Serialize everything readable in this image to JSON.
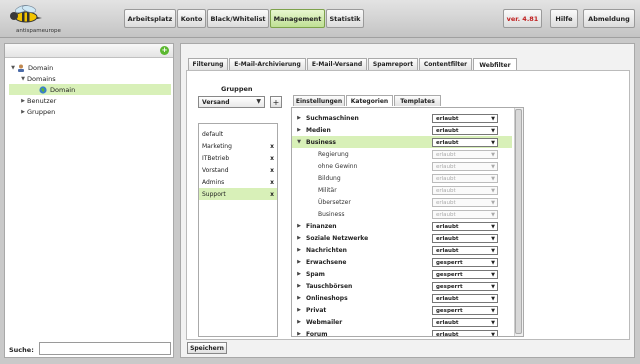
{
  "brand": {
    "logo_text": "antispameurope"
  },
  "nav": {
    "items": [
      {
        "label": "Arbeitsplatz"
      },
      {
        "label": "Konto"
      },
      {
        "label": "Black/Whitelist"
      },
      {
        "label": "Management"
      },
      {
        "label": "Statistik"
      }
    ],
    "version": "ver. 4.81",
    "help": "Hilfe",
    "logout": "Abmeldung"
  },
  "tree": {
    "nodes": [
      {
        "label": "Domain"
      },
      {
        "label": "Domains"
      },
      {
        "label": "Domain"
      },
      {
        "label": "Benutzer"
      },
      {
        "label": "Gruppen"
      }
    ]
  },
  "search": {
    "label": "Suche:",
    "value": ""
  },
  "tabs": [
    {
      "label": "Filterung"
    },
    {
      "label": "E-Mail-Archivierung"
    },
    {
      "label": "E-Mail-Versand"
    },
    {
      "label": "Spamreport"
    },
    {
      "label": "Contentfilter"
    },
    {
      "label": "Webfilter"
    }
  ],
  "groups": {
    "title": "Gruppen",
    "select_value": "Versand",
    "add_label": "+",
    "items": [
      {
        "label": "default",
        "removable": ""
      },
      {
        "label": "Marketing",
        "removable": "x"
      },
      {
        "label": "ITBetrieb",
        "removable": "x"
      },
      {
        "label": "Vorstand",
        "removable": "x"
      },
      {
        "label": "Admins",
        "removable": "x"
      },
      {
        "label": "Support",
        "removable": "x"
      }
    ]
  },
  "subtabs": [
    {
      "label": "Einstellungen"
    },
    {
      "label": "Kategorien"
    },
    {
      "label": "Templates"
    }
  ],
  "categories": [
    {
      "label": "Suchmaschinen",
      "value": "erlaubt"
    },
    {
      "label": "Medien",
      "value": "erlaubt"
    },
    {
      "label": "Business",
      "value": "erlaubt"
    },
    {
      "label": "Regierung",
      "value": "erlaubt"
    },
    {
      "label": "ohne Gewinn",
      "value": "erlaubt"
    },
    {
      "label": "Bildung",
      "value": "erlaubt"
    },
    {
      "label": "Militär",
      "value": "erlaubt"
    },
    {
      "label": "Übersetzer",
      "value": "erlaubt"
    },
    {
      "label": "Business",
      "value": "erlaubt"
    },
    {
      "label": "Finanzen",
      "value": "erlaubt"
    },
    {
      "label": "Soziale Netzwerke",
      "value": "erlaubt"
    },
    {
      "label": "Nachrichten",
      "value": "erlaubt"
    },
    {
      "label": "Erwachsene",
      "value": "gesperrt"
    },
    {
      "label": "Spam",
      "value": "gesperrt"
    },
    {
      "label": "Tauschbörsen",
      "value": "gesperrt"
    },
    {
      "label": "Onlineshops",
      "value": "erlaubt"
    },
    {
      "label": "Privat",
      "value": "gesperrt"
    },
    {
      "label": "Webmailer",
      "value": "erlaubt"
    },
    {
      "label": "Forum",
      "value": "erlaubt"
    }
  ],
  "save_label": "Speichern",
  "colors": {
    "accent": "#5bb830",
    "selected_bg": "#d8f0b8",
    "version_red": "#c02020"
  }
}
